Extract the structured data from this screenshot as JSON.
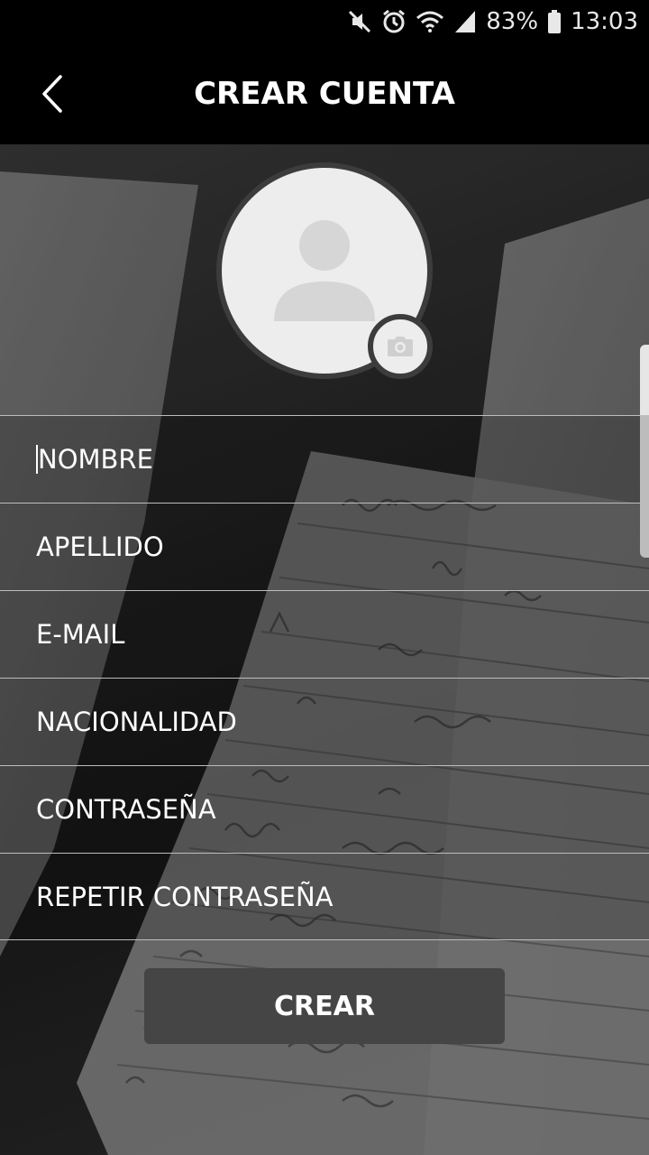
{
  "status_bar": {
    "battery": "83%",
    "time": "13:03",
    "icons": [
      "mute-icon",
      "alarm-icon",
      "wifi-icon",
      "signal-icon",
      "battery-icon"
    ]
  },
  "header": {
    "title": "CREAR CUENTA",
    "back_icon": "chevron-left-icon"
  },
  "profile": {
    "avatar_icon": "user-placeholder-icon",
    "camera_icon": "camera-icon"
  },
  "form": {
    "fields": [
      {
        "label": "NOMBRE"
      },
      {
        "label": "APELLIDO"
      },
      {
        "label": "E-MAIL"
      },
      {
        "label": "NACIONALIDAD"
      },
      {
        "label": "CONTRASEÑA"
      },
      {
        "label": "REPETIR CONTRASEÑA"
      }
    ],
    "submit_label": "CREAR"
  },
  "colors": {
    "bar_background": "#000000",
    "button_background": "#454545",
    "avatar_fill": "#ededed",
    "divider": "#bdbdbd"
  }
}
